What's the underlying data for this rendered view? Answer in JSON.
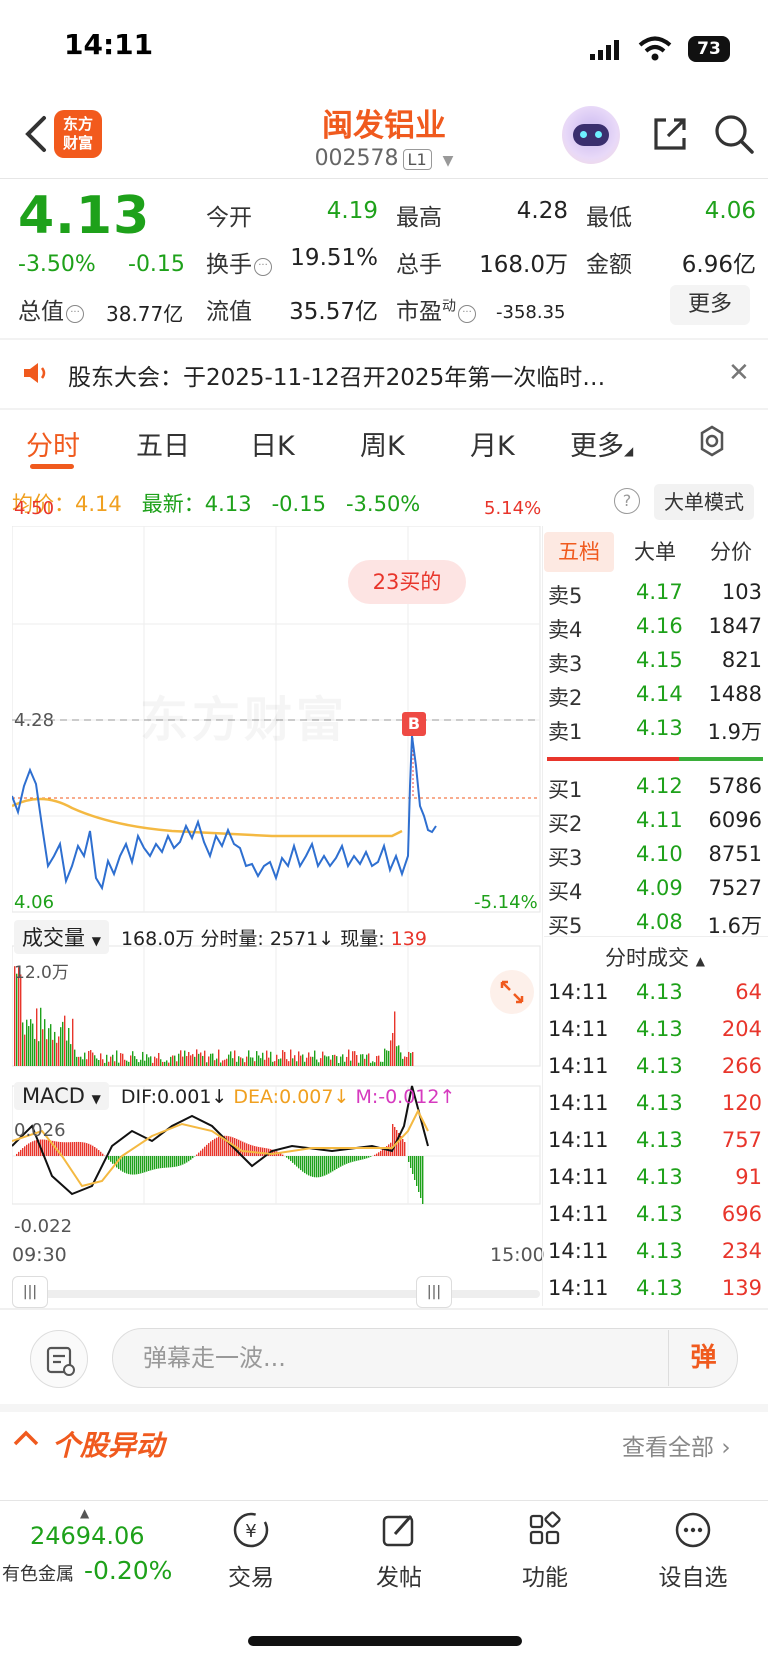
{
  "status": {
    "time": "14:11",
    "battery": "73"
  },
  "header": {
    "name": "闽发铝业",
    "code": "002578",
    "level": "L1",
    "logo_line1": "东方",
    "logo_line2": "财富"
  },
  "quote": {
    "price": "4.13",
    "pct": "-3.50%",
    "change": "-0.15",
    "open_label": "今开",
    "open": "4.19",
    "high_label": "最高",
    "high": "4.28",
    "low_label": "最低",
    "low": "4.06",
    "turnover_label": "换手",
    "turnover": "19.51%",
    "volume_label": "总手",
    "volume": "168.0万",
    "amount_label": "金额",
    "amount": "6.96亿",
    "mktcap_label": "总值",
    "mktcap": "38.77亿",
    "float_label": "流值",
    "float": "35.57亿",
    "pe_label": "市盈",
    "pe_sup": "动",
    "pe": "-358.35",
    "more": "更多"
  },
  "notice": {
    "text": "股东大会：于2025-11-12召开2025年第一次临时…"
  },
  "tabs": [
    "分时",
    "五日",
    "日K",
    "周K",
    "月K",
    "更多"
  ],
  "stat_line": {
    "avg_label": "均价：",
    "avg": "4.14",
    "latest_label": "最新：",
    "latest": "4.13",
    "change": "-0.15",
    "pct": "-3.50%",
    "mode": "大单模式"
  },
  "chart": {
    "top_left": "4.50",
    "top_right": "5.14%",
    "ref": "4.28",
    "bottom_left": "4.06",
    "bottom_right": "-5.14%",
    "bubble": "23买的",
    "marker": "B",
    "watermark": "东方财富",
    "time_start": "09:30",
    "time_end": "15:00"
  },
  "volume_panel": {
    "select": "成交量",
    "total": "168.0万",
    "fs_label": "分时量:",
    "fs_val": "2571",
    "cur_label": "现量:",
    "cur_val": "139",
    "axis_max": "12.0万"
  },
  "macd_panel": {
    "select": "MACD",
    "dif": "DIF:0.001",
    "dea": "DEA:0.007",
    "m": "M:-0.012",
    "axis_max": "0.026",
    "axis_min": "-0.022"
  },
  "orderbook": {
    "tabs": [
      "五档",
      "大单",
      "分价"
    ],
    "asks": [
      {
        "label": "卖5",
        "price": "4.17",
        "vol": "103"
      },
      {
        "label": "卖4",
        "price": "4.16",
        "vol": "1847"
      },
      {
        "label": "卖3",
        "price": "4.15",
        "vol": "821"
      },
      {
        "label": "卖2",
        "price": "4.14",
        "vol": "1488"
      },
      {
        "label": "卖1",
        "price": "4.13",
        "vol": "1.9万"
      }
    ],
    "bids": [
      {
        "label": "买1",
        "price": "4.12",
        "vol": "5786"
      },
      {
        "label": "买2",
        "price": "4.11",
        "vol": "6096"
      },
      {
        "label": "买3",
        "price": "4.10",
        "vol": "8751"
      },
      {
        "label": "买4",
        "price": "4.09",
        "vol": "7527"
      },
      {
        "label": "买5",
        "price": "4.08",
        "vol": "1.6万"
      }
    ],
    "ticks_title": "分时成交",
    "ticks": [
      {
        "t": "14:11",
        "p": "4.13",
        "v": "64"
      },
      {
        "t": "14:11",
        "p": "4.13",
        "v": "204"
      },
      {
        "t": "14:11",
        "p": "4.13",
        "v": "266"
      },
      {
        "t": "14:11",
        "p": "4.13",
        "v": "120"
      },
      {
        "t": "14:11",
        "p": "4.13",
        "v": "757"
      },
      {
        "t": "14:11",
        "p": "4.13",
        "v": "91"
      },
      {
        "t": "14:11",
        "p": "4.13",
        "v": "696"
      },
      {
        "t": "14:11",
        "p": "4.13",
        "v": "234"
      },
      {
        "t": "14:11",
        "p": "4.13",
        "v": "139"
      }
    ]
  },
  "comment": {
    "placeholder": "弹幕走一波...",
    "danmu": "弹"
  },
  "movement": {
    "title": "个股异动",
    "view_all": "查看全部"
  },
  "bottom": {
    "index_value": "24694.06",
    "index_name": "有色金属",
    "index_pct": "-0.20%",
    "nav": [
      "交易",
      "发帖",
      "功能",
      "设自选"
    ]
  },
  "colors": {
    "accent": "#f05a1e",
    "up": "#e8352b",
    "down": "#1ea11a",
    "avg_line": "#f4b942",
    "price_line": "#2e6fd0"
  }
}
